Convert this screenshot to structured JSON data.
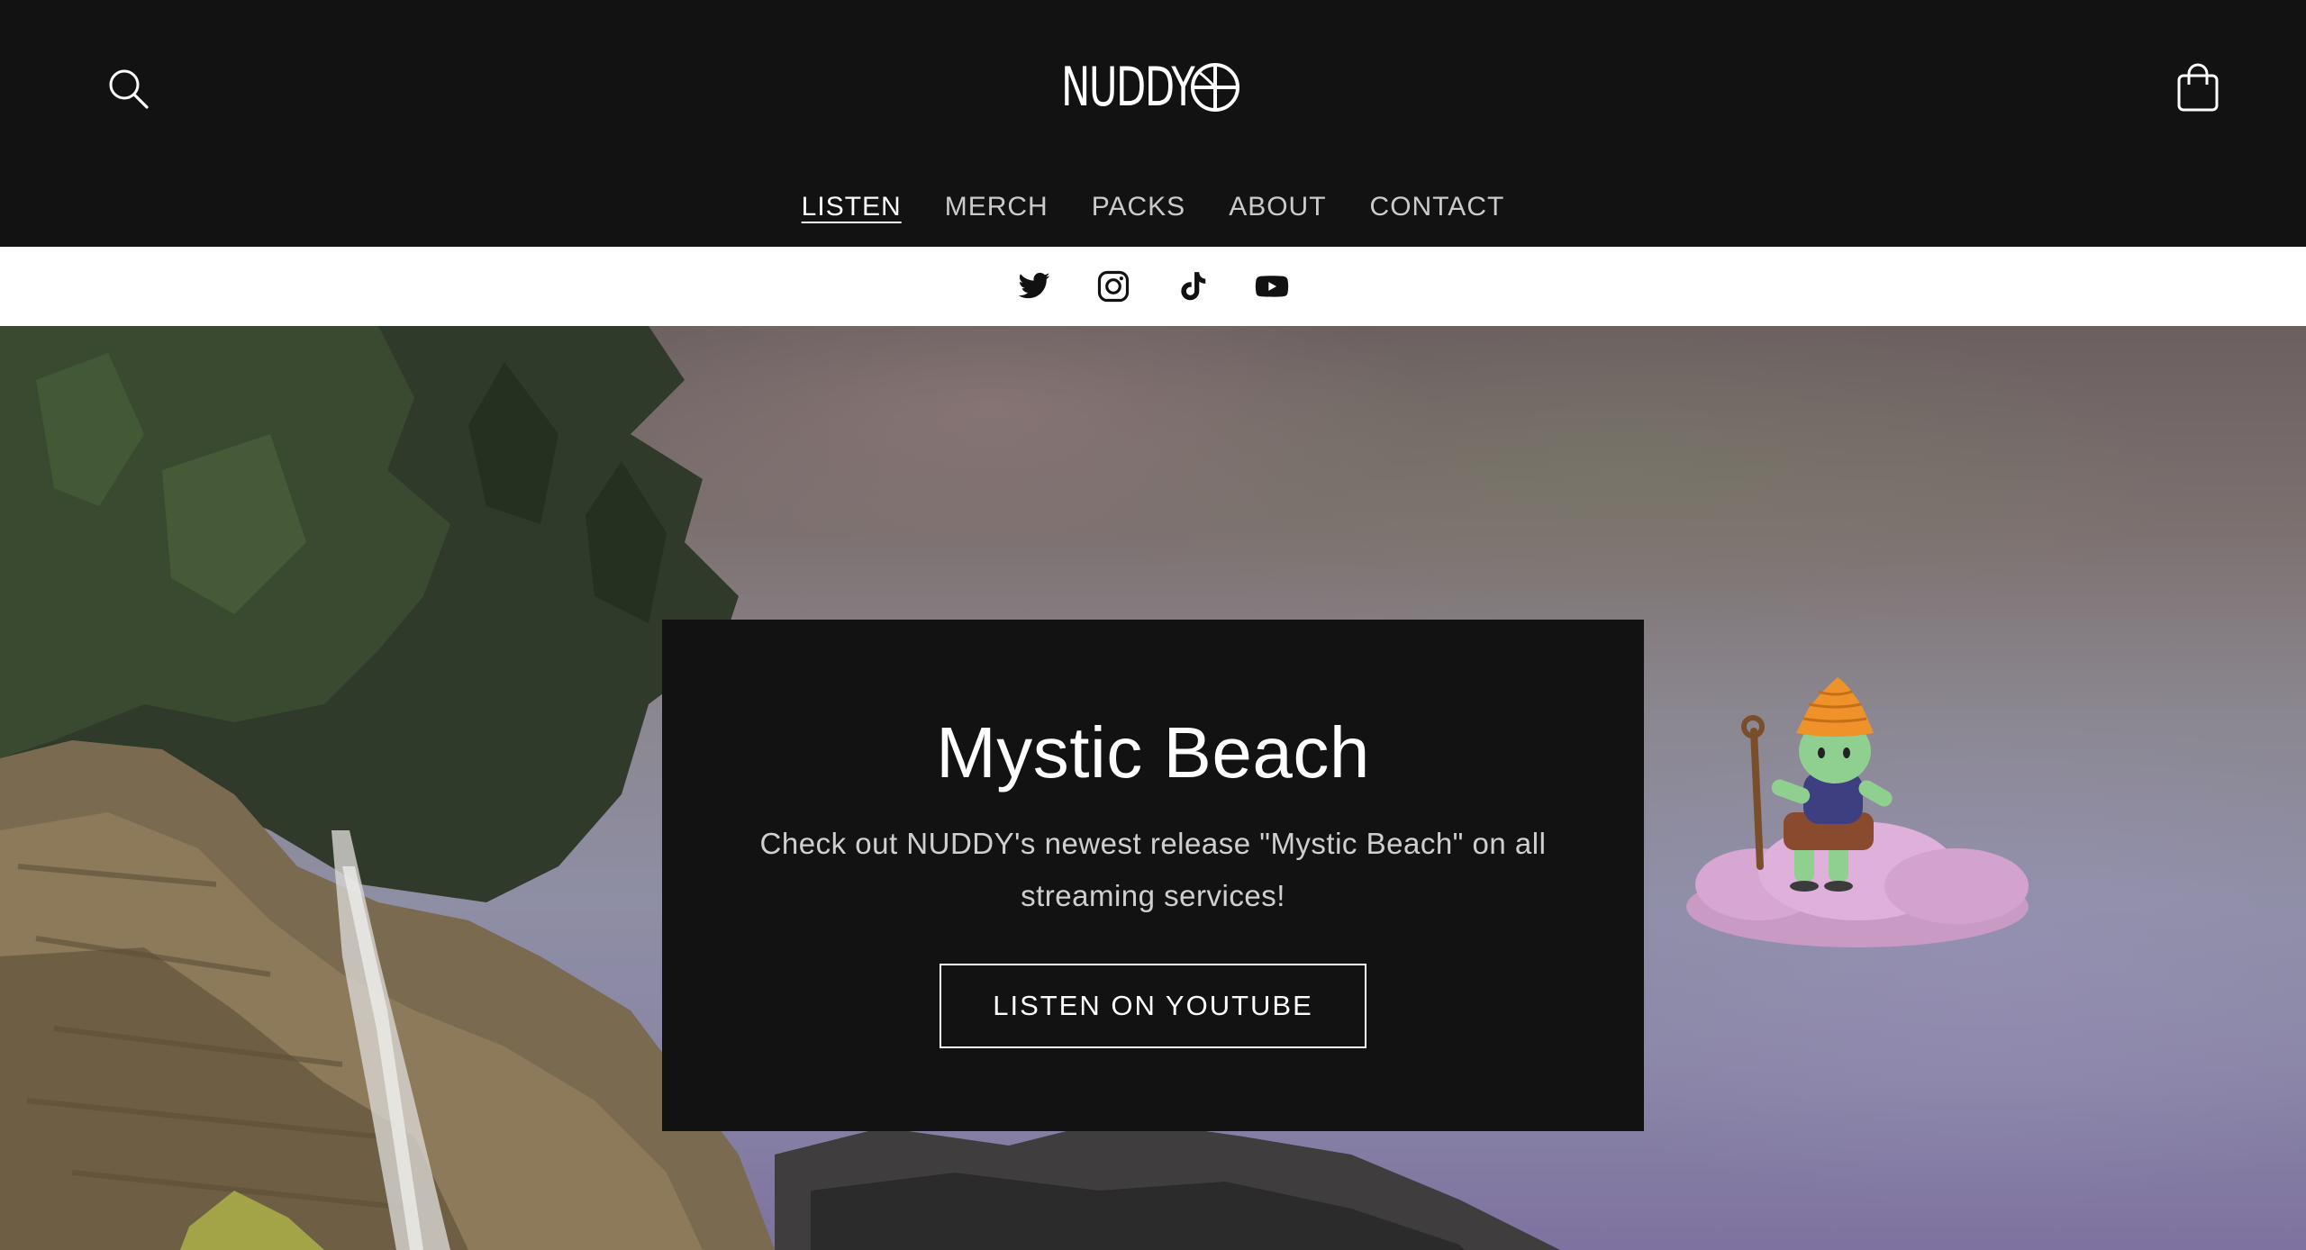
{
  "header": {
    "logo_text": "NUDDY",
    "search_icon": "search-icon",
    "cart_icon": "cart-icon"
  },
  "nav": {
    "items": [
      {
        "label": "LISTEN",
        "active": true
      },
      {
        "label": "MERCH"
      },
      {
        "label": "PACKS"
      },
      {
        "label": "ABOUT"
      },
      {
        "label": "CONTACT"
      }
    ]
  },
  "social": {
    "icons": [
      "twitter-icon",
      "instagram-icon",
      "tiktok-icon",
      "youtube-icon"
    ]
  },
  "hero": {
    "title": "Mystic Beach",
    "subtitle": "Check out NUDDY's newest release \"Mystic Beach\" on all streaming services!",
    "button_label": "LISTEN ON YOUTUBE"
  },
  "colors": {
    "header_bg": "#121212",
    "social_bar_bg": "#ffffff",
    "card_bg": "#121212",
    "text": "#ffffff"
  }
}
